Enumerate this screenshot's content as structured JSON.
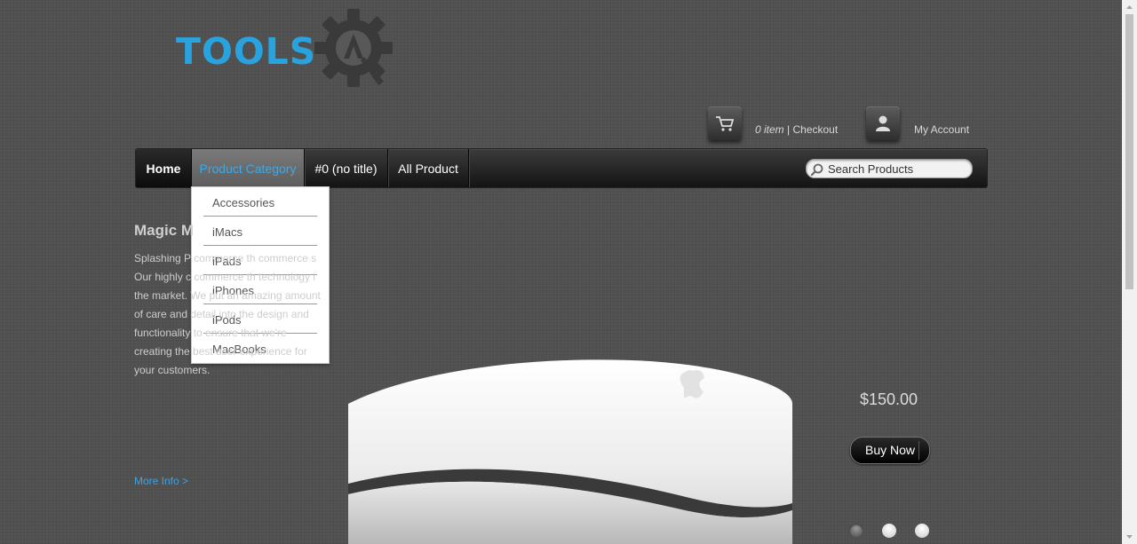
{
  "brand": {
    "logo_text": "TOOLS",
    "logo_color": "#29a3e0"
  },
  "header": {
    "cart": {
      "count": "0 item",
      "separator": " | ",
      "checkout_label": "Checkout",
      "icon": "cart-icon"
    },
    "account": {
      "label": "My Account",
      "icon": "user-icon"
    }
  },
  "nav": {
    "items": [
      {
        "label": "Home"
      },
      {
        "label": "Product Category"
      },
      {
        "label": "#0 (no title)"
      },
      {
        "label": "All Product"
      }
    ],
    "search": {
      "placeholder": "Search Products",
      "value": "",
      "icon": "search-icon"
    }
  },
  "dropdown": {
    "items": [
      "Accessories",
      "iMacs",
      "iPads",
      "iPhones",
      "iPods",
      "MacBooks"
    ]
  },
  "slide": {
    "title": "Magic M",
    "description": "Splashing P commerce th commerce s Our highly c commerce th technology i the market. We put an amazing amount of care and detail into the design and functionality to ensure that we're creating the best user experience for your customers.",
    "more_info": "More Info >",
    "price": "$150.00",
    "buy_label": "Buy Now"
  },
  "colors": {
    "accent": "#3ba3e2",
    "background": "#505050"
  }
}
